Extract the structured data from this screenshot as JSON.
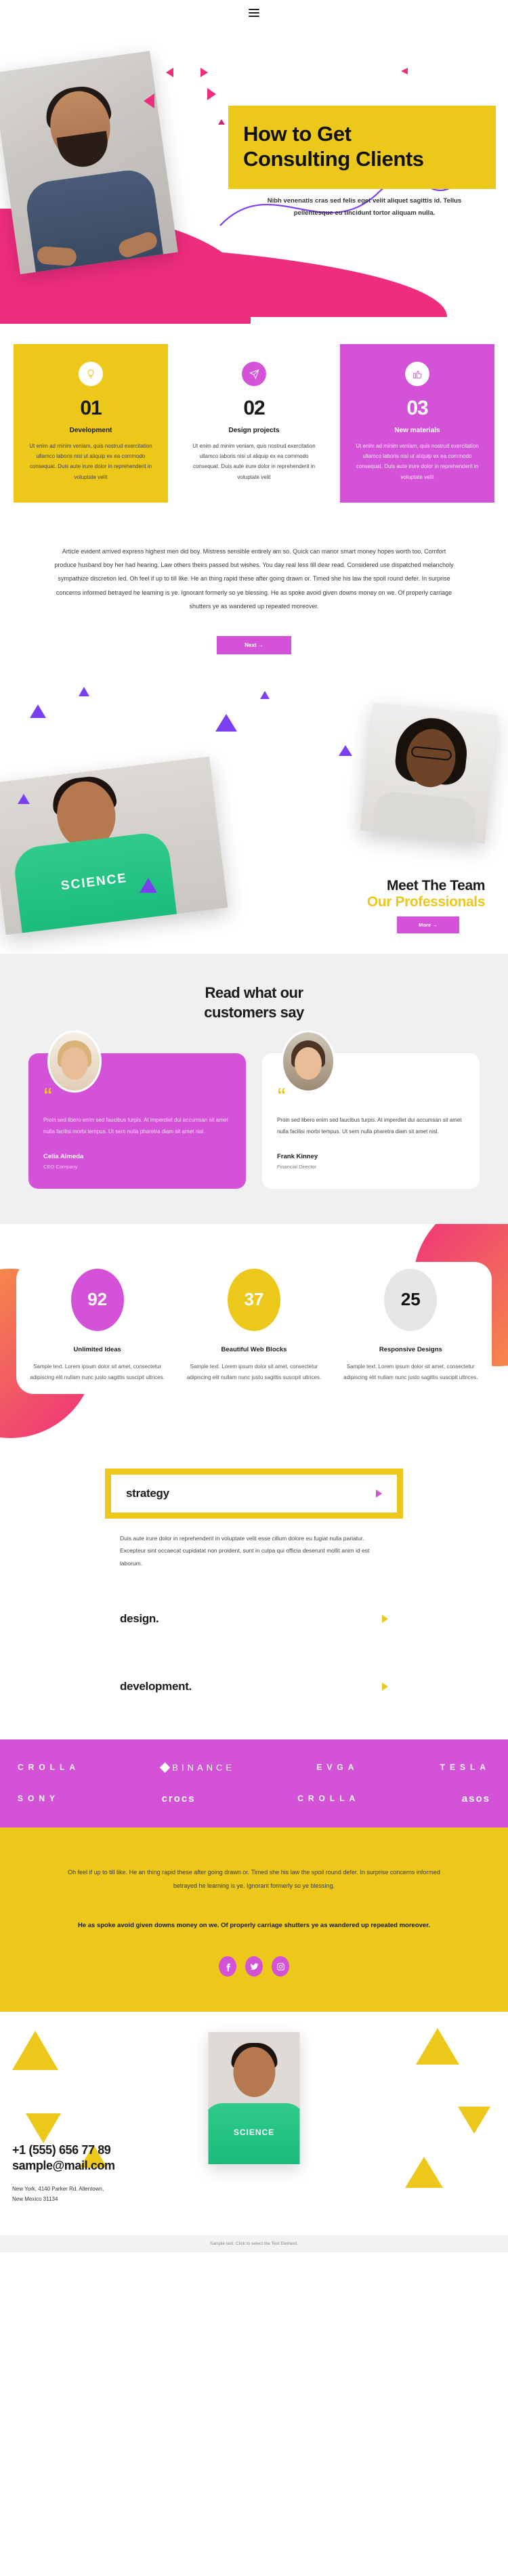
{
  "nav": {
    "menu_label": "menu"
  },
  "hero": {
    "title_line1": "How to Get",
    "title_line2": "Consulting Clients",
    "subtitle_line1": "Nibh venenatis cras sed felis eget velit aliquet sagittis id. Tellus",
    "subtitle_line2": "pellentesque eu tincidunt tortor aliquam nulla."
  },
  "features": [
    {
      "icon": "lightbulb-icon",
      "glyph": "☀",
      "number": "01",
      "title": "Development",
      "desc": "Ut enim ad minim veniam, quis nostrud exercitation ullamco laboris nisi ut aliquip ex ea commodo consequat. Duis aute irure dolor in reprehenderit in voluptate velit"
    },
    {
      "icon": "paper-plane-icon",
      "glyph": "➤",
      "number": "02",
      "title": "Design projects",
      "desc": "Ut enim ad minim veniam, quis nostrud exercitation ullamco laboris nisi ut aliquip ex ea commodo consequat. Duis aute irure dolor in reprehenderit in voluptate velit"
    },
    {
      "icon": "thumbs-up-icon",
      "glyph": "👍",
      "number": "03",
      "title": "New materials",
      "desc": "Ut enim ad minim veniam, quis nostrud exercitation ullamco laboris nisi ut aliquip ex ea commodo consequat. Duis aute irure dolor in reprehenderit in voluptate velit"
    }
  ],
  "intro": {
    "paragraph": "Article evident arrived express highest men did boy. Mistress sensible entirely am so. Quick can manor smart money hopes worth too. Comfort produce husband boy her had hearing. Law others theirs passed but wishes. You day real less till dear read. Considered use dispatched melancholy sympathize discretion led. Oh feel if up to till like. He an thing rapid these after going drawn or. Timed she his law the spoil round defer. In surprise concerns informed betrayed he learning is ye. Ignorant formerly so ye blessing. He as spoke avoid given downs money on we. Of properly carriage shutters ye as wandered up repeated moreover.",
    "button_label": "Next →"
  },
  "team": {
    "heading_line1": "Meet The Team",
    "heading_line2": "Our Professionals",
    "button_label": "More →",
    "shirt_text": "SCIENCE"
  },
  "testimonials": {
    "heading_line1": "Read what our",
    "heading_line2": "customers say",
    "quote_mark": "“",
    "items": [
      {
        "text": "Proin sed libero enim sed faucibus turpis. At imperdiet dui accumsan sit amet nulla facilisi morbi tempus. Ut sem nulla pharetra diam sit amet nisl.",
        "name": "Celia Almeda",
        "role": "CEO Company"
      },
      {
        "text": "Proin sed libero enim sed faucibus turpis. At imperdiet dui accumsan sit amet nulla facilisi morbi tempus. Ut sem nulla pharetra diam sit amet nisl.",
        "name": "Frank Kinney",
        "role": "Financial Director"
      }
    ]
  },
  "stats": [
    {
      "value": "92",
      "title": "Unlimited Ideas",
      "desc": "Sample text. Lorem ipsum dolor sit amet, consectetur adipiscing elit nullam nunc justo sagittis suscipit ultrices."
    },
    {
      "value": "37",
      "title": "Beautiful Web Blocks",
      "desc": "Sample text. Lorem ipsum dolor sit amet, consectetur adipiscing elit nullam nunc justo sagittis suscipit ultrices."
    },
    {
      "value": "25",
      "title": "Responsive Designs",
      "desc": "Sample text. Lorem ipsum dolor sit amet, consectetur adipiscing elit nullam nunc justo sagittis suscipit ultrices."
    }
  ],
  "accordion": {
    "open": {
      "label": "strategy",
      "body": "Duis aute irure dolor in reprehenderit in voluptate velit esse cillum dolore eu fugiat nulla pariatur. Excepteur sint occaecat cupidatat non proident, sunt in culpa qui officia deserunt mollit anim id est laborum."
    },
    "closed": [
      {
        "label": "design."
      },
      {
        "label": "development."
      }
    ]
  },
  "logos": {
    "row1": [
      "CROLLA",
      "BINANCE",
      "EVGA",
      "TESLA"
    ],
    "row2": [
      "SONY",
      "crocs",
      "CROLLA",
      "asos"
    ]
  },
  "cta": {
    "paragraph": "Oh feel if up to till like. He an thing rapid these after going drawn or. Timed she his law the spoil round defer. In surprise concerns informed betrayed he learning is ye. Ignorant formerly so ye blessing.",
    "bold_paragraph": "He as spoke avoid given downs money on we. Of properly carriage shutters ye as wandered up repeated moreover.",
    "socials": [
      {
        "name": "facebook-icon",
        "glyph": "f"
      },
      {
        "name": "twitter-icon",
        "glyph": "🐦"
      },
      {
        "name": "instagram-icon",
        "glyph": "▣"
      }
    ]
  },
  "contact": {
    "phone": "+1 (555) 656 77 89",
    "email": "sample@mail.com",
    "address_line1": "New York, 4140 Parker Rd. Allentown,",
    "address_line2": "New Mexico 31134",
    "shirt_text": "SCIENCE"
  },
  "bottom_bar": {
    "text": "Sample text. Click to select the Text Element."
  },
  "colors": {
    "yellow": "#ecc81b",
    "violet": "#d352d8",
    "pink": "#ef2d7e",
    "purple": "#7b3ff2",
    "orange": "#f7a03c"
  }
}
